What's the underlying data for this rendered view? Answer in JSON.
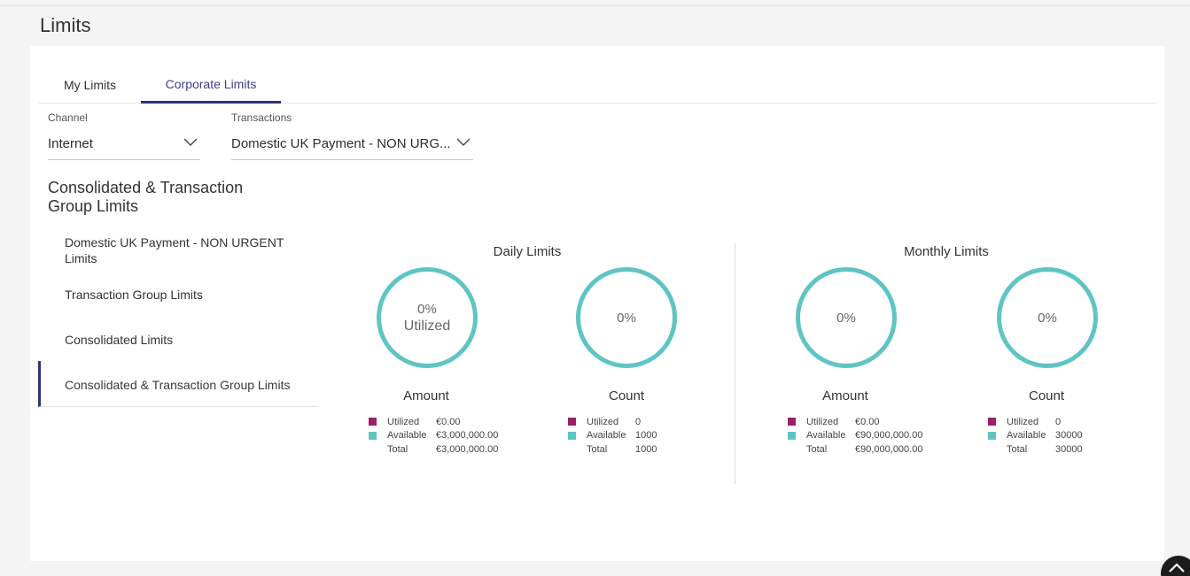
{
  "page": {
    "title": "Limits"
  },
  "tabs": [
    {
      "label": "My Limits",
      "active": false
    },
    {
      "label": "Corporate Limits",
      "active": true
    }
  ],
  "filters": {
    "channel": {
      "label": "Channel",
      "value": "Internet"
    },
    "transactions": {
      "label": "Transactions",
      "value": "Domestic UK Payment - NON URG..."
    }
  },
  "section_title": "Consolidated & Transaction Group Limits",
  "nav": [
    {
      "label": "Domestic UK Payment - NON URGENT Limits"
    },
    {
      "label": "Transaction Group Limits"
    },
    {
      "label": "Consolidated Limits"
    },
    {
      "label": "Consolidated & Transaction Group Limits",
      "active": true
    }
  ],
  "colors": {
    "utilized": "#9b1f6a",
    "available": "#5fc4c4",
    "accent": "#2f3575"
  },
  "daily": {
    "title": "Daily Limits",
    "amount": {
      "donut_pct": "0%",
      "donut_sub": "Utilized",
      "title": "Amount",
      "rows": [
        {
          "label": "Utilized",
          "value": "€0.00"
        },
        {
          "label": "Available",
          "value": "€3,000,000.00"
        },
        {
          "label": "Total",
          "value": "€3,000,000.00"
        }
      ]
    },
    "count": {
      "donut_pct": "0%",
      "title": "Count",
      "rows": [
        {
          "label": "Utilized",
          "value": "0"
        },
        {
          "label": "Available",
          "value": "1000"
        },
        {
          "label": "Total",
          "value": "1000"
        }
      ]
    }
  },
  "monthly": {
    "title": "Monthly Limits",
    "amount": {
      "donut_pct": "0%",
      "title": "Amount",
      "rows": [
        {
          "label": "Utilized",
          "value": "€0.00"
        },
        {
          "label": "Available",
          "value": "€90,000,000.00"
        },
        {
          "label": "Total",
          "value": "€90,000,000.00"
        }
      ]
    },
    "count": {
      "donut_pct": "0%",
      "title": "Count",
      "rows": [
        {
          "label": "Utilized",
          "value": "0"
        },
        {
          "label": "Available",
          "value": "30000"
        },
        {
          "label": "Total",
          "value": "30000"
        }
      ]
    }
  }
}
